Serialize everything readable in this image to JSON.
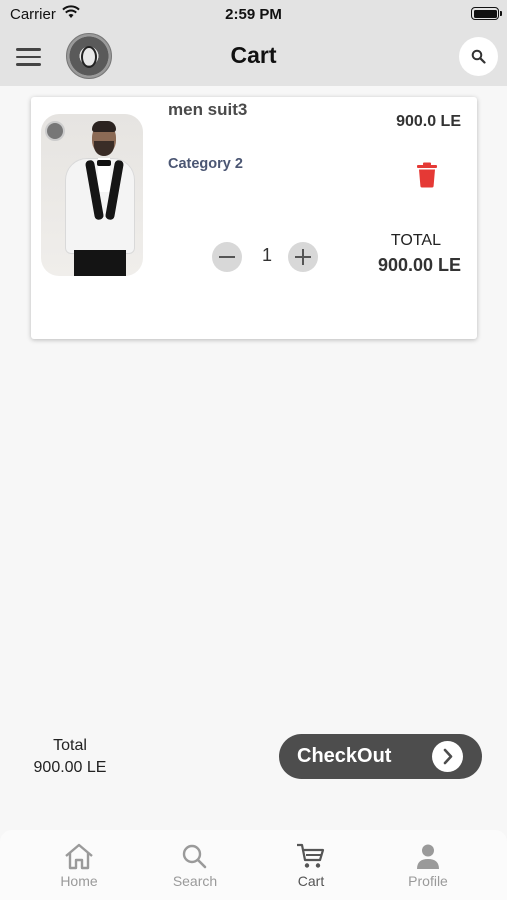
{
  "status_bar": {
    "carrier": "Carrier",
    "time": "2:59 PM"
  },
  "header": {
    "title": "Cart",
    "menu_icon": "menu-icon",
    "search_icon": "search-icon"
  },
  "cart": {
    "items": [
      {
        "name": "men suit3",
        "category": "Category 2",
        "unit_price": "900.0 LE",
        "quantity": "1",
        "total_label": "TOTAL",
        "total_value": "900.00 LE",
        "delete_icon": "trash-icon"
      }
    ]
  },
  "summary": {
    "label": "Total",
    "value": "900.00 LE"
  },
  "checkout": {
    "label": "CheckOut",
    "icon": "chevron-right-icon"
  },
  "tabs": [
    {
      "label": "Home",
      "icon": "home-icon"
    },
    {
      "label": "Search",
      "icon": "search-icon"
    },
    {
      "label": "Cart",
      "icon": "cart-icon",
      "active": true
    },
    {
      "label": "Profile",
      "icon": "person-icon"
    }
  ],
  "colors": {
    "header_bg": "#e3e3e3",
    "delete_red": "#e53935",
    "checkout_bg": "#4d4d4d",
    "category_text": "#4b5673"
  }
}
